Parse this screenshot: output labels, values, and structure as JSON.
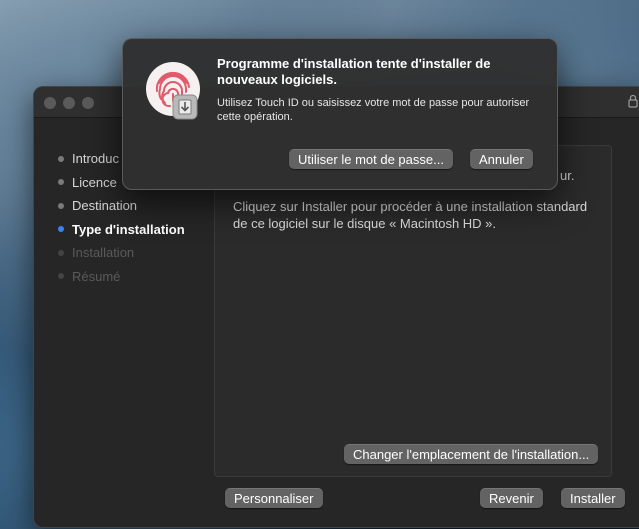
{
  "installer": {
    "partial_text": "ur.",
    "description": "Cliquez sur Installer pour procéder à une installation standard de ce logiciel sur le disque « Macintosh HD ».",
    "steps": [
      {
        "label": "Introduc",
        "state": "done"
      },
      {
        "label": "Licence",
        "state": "done"
      },
      {
        "label": "Destination",
        "state": "done"
      },
      {
        "label": "Type d'installation",
        "state": "active"
      },
      {
        "label": "Installation",
        "state": "pending"
      },
      {
        "label": "Résumé",
        "state": "pending"
      }
    ],
    "change_location_label": "Changer l'emplacement de l'installation...",
    "customize_label": "Personnaliser",
    "back_label": "Revenir",
    "install_label": "Installer"
  },
  "dialog": {
    "title": "Programme d'installation tente d'installer de nouveaux logiciels.",
    "message": "Utilisez Touch ID ou saisissez votre mot de passe pour autoriser cette opération.",
    "use_password_label": "Utiliser le mot de passe...",
    "cancel_label": "Annuler"
  },
  "colors": {
    "accent": "#3b82f6",
    "fingerprint": "#e05a6a"
  }
}
